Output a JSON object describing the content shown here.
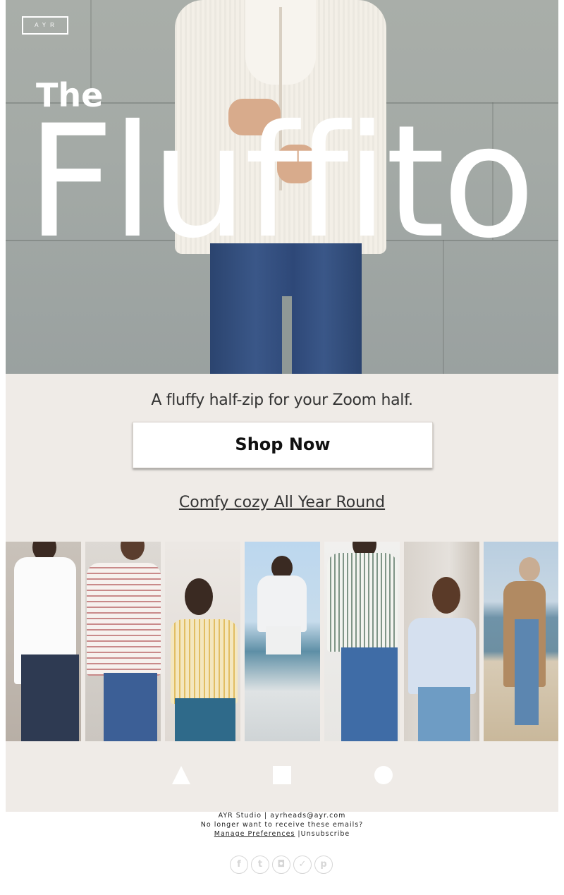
{
  "hero": {
    "logo": "AYR",
    "title_small": "The",
    "title_large": "Fluffito"
  },
  "cta": {
    "tagline": "A fluffy half-zip for your Zoom half.",
    "button_label": "Shop Now",
    "sublink": "Comfy cozy All Year Round"
  },
  "gallery": {
    "count": 7
  },
  "shapes": [
    "triangle-icon",
    "square-icon",
    "circle-icon"
  ],
  "footer": {
    "line1": "AYR Studio | ayrheads@ayr.com",
    "line2": "No longer want to receive these emails?",
    "manage": "Manage Preferences",
    "separator": " |",
    "unsubscribe": "Unsubscribe"
  },
  "socials": [
    {
      "icon": "facebook-icon",
      "glyph": "f"
    },
    {
      "icon": "tumblr-icon",
      "glyph": "t"
    },
    {
      "icon": "instagram-icon",
      "glyph": "◘"
    },
    {
      "icon": "twitter-icon",
      "glyph": "✓"
    },
    {
      "icon": "pinterest-icon",
      "glyph": "p"
    }
  ],
  "colors": {
    "background": "#efebe7",
    "button": "#ffffff",
    "text": "#333333"
  }
}
